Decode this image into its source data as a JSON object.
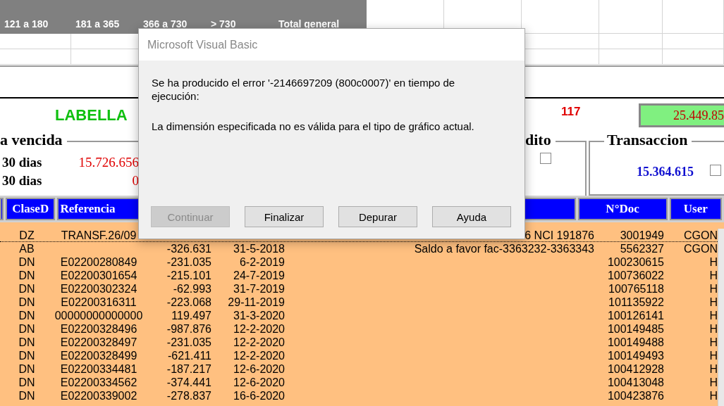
{
  "spreadsheet": {
    "headers": [
      "121 a 180",
      "181 a 365",
      "366 a 730",
      "> 730",
      "Total general"
    ]
  },
  "form": {
    "client": "LABELLA",
    "count": "117",
    "total": "25.449.85",
    "overdue_group": {
      "title": "a vencida",
      "rows": [
        {
          "label": "30 dias",
          "value": "15.726.656"
        },
        {
          "label": "30 dias",
          "value": "0"
        }
      ]
    },
    "credit_group": {
      "title": "dito",
      "checked": false
    },
    "transaction_group": {
      "title": "Transaccion",
      "value": "15.364.615",
      "checked": false
    },
    "table": {
      "columns": [
        "ClaseD",
        "Referencia",
        "N°Doc",
        "User"
      ],
      "rows": [
        {
          "selected": true,
          "clase": "DZ",
          "referencia": "TRANSF.26/09",
          "column_5": "6 NCI 191876",
          "ndoc": "3001949",
          "user": "CGON"
        },
        {
          "selected": false,
          "clase": "AB",
          "column_3": "-326.631",
          "column_4": "31-5-2018",
          "column_5": "Saldo a favor fac-3363232-3363343",
          "ndoc": "5562327",
          "user": "CGON"
        },
        {
          "selected": false,
          "clase": "DN",
          "referencia": "E02200280849",
          "column_3": "-231.035",
          "column_4": "6-2-2019",
          "ndoc": "100230615",
          "user": "H"
        },
        {
          "selected": false,
          "clase": "DN",
          "referencia": "E02200301654",
          "column_3": "-215.101",
          "column_4": "24-7-2019",
          "ndoc": "100736022",
          "user": "H"
        },
        {
          "selected": false,
          "clase": "DN",
          "referencia": "E02200302324",
          "column_3": "-62.993",
          "column_4": "31-7-2019",
          "ndoc": "100765118",
          "user": "H"
        },
        {
          "selected": false,
          "clase": "DN",
          "referencia": "E02200316311",
          "column_3": "-223.068",
          "column_4": "29-11-2019",
          "ndoc": "101135922",
          "user": "H"
        },
        {
          "selected": false,
          "clase": "DN",
          "referencia": "00000000000000",
          "column_3": "119.497",
          "column_4": "31-3-2020",
          "ndoc": "100126141",
          "user": "H"
        },
        {
          "selected": false,
          "clase": "DN",
          "referencia": "E02200328496",
          "column_3": "-987.876",
          "column_4": "12-2-2020",
          "ndoc": "100149485",
          "user": "H"
        },
        {
          "selected": false,
          "clase": "DN",
          "referencia": "E02200328497",
          "column_3": "-231.035",
          "column_4": "12-2-2020",
          "ndoc": "100149488",
          "user": "H"
        },
        {
          "selected": false,
          "clase": "DN",
          "referencia": "E02200328499",
          "column_3": "-621.411",
          "column_4": "12-2-2020",
          "ndoc": "100149493",
          "user": "H"
        },
        {
          "selected": false,
          "clase": "DN",
          "referencia": "E02200334481",
          "column_3": "-187.217",
          "column_4": "12-6-2020",
          "ndoc": "100412928",
          "user": "H"
        },
        {
          "selected": false,
          "clase": "DN",
          "referencia": "E02200334562",
          "column_3": "-374.441",
          "column_4": "12-6-2020",
          "ndoc": "100413048",
          "user": "H"
        },
        {
          "selected": false,
          "clase": "DN",
          "referencia": "E02200339002",
          "column_3": "-278.837",
          "column_4": "16-6-2020",
          "ndoc": "100423876",
          "user": "H"
        }
      ]
    }
  },
  "dialog": {
    "title": "Microsoft Visual Basic",
    "message": [
      "Se ha producido el error '-2146697209 (800c0007)' en tiempo de ejecución:",
      "La dimensión especificada no es válida para el tipo de gráfico actual."
    ],
    "buttons": [
      {
        "label": "Continuar",
        "disabled": true
      },
      {
        "label": "Finalizar",
        "disabled": false
      },
      {
        "label": "Depurar",
        "disabled": false
      },
      {
        "label": "Ayuda",
        "disabled": false
      }
    ]
  }
}
